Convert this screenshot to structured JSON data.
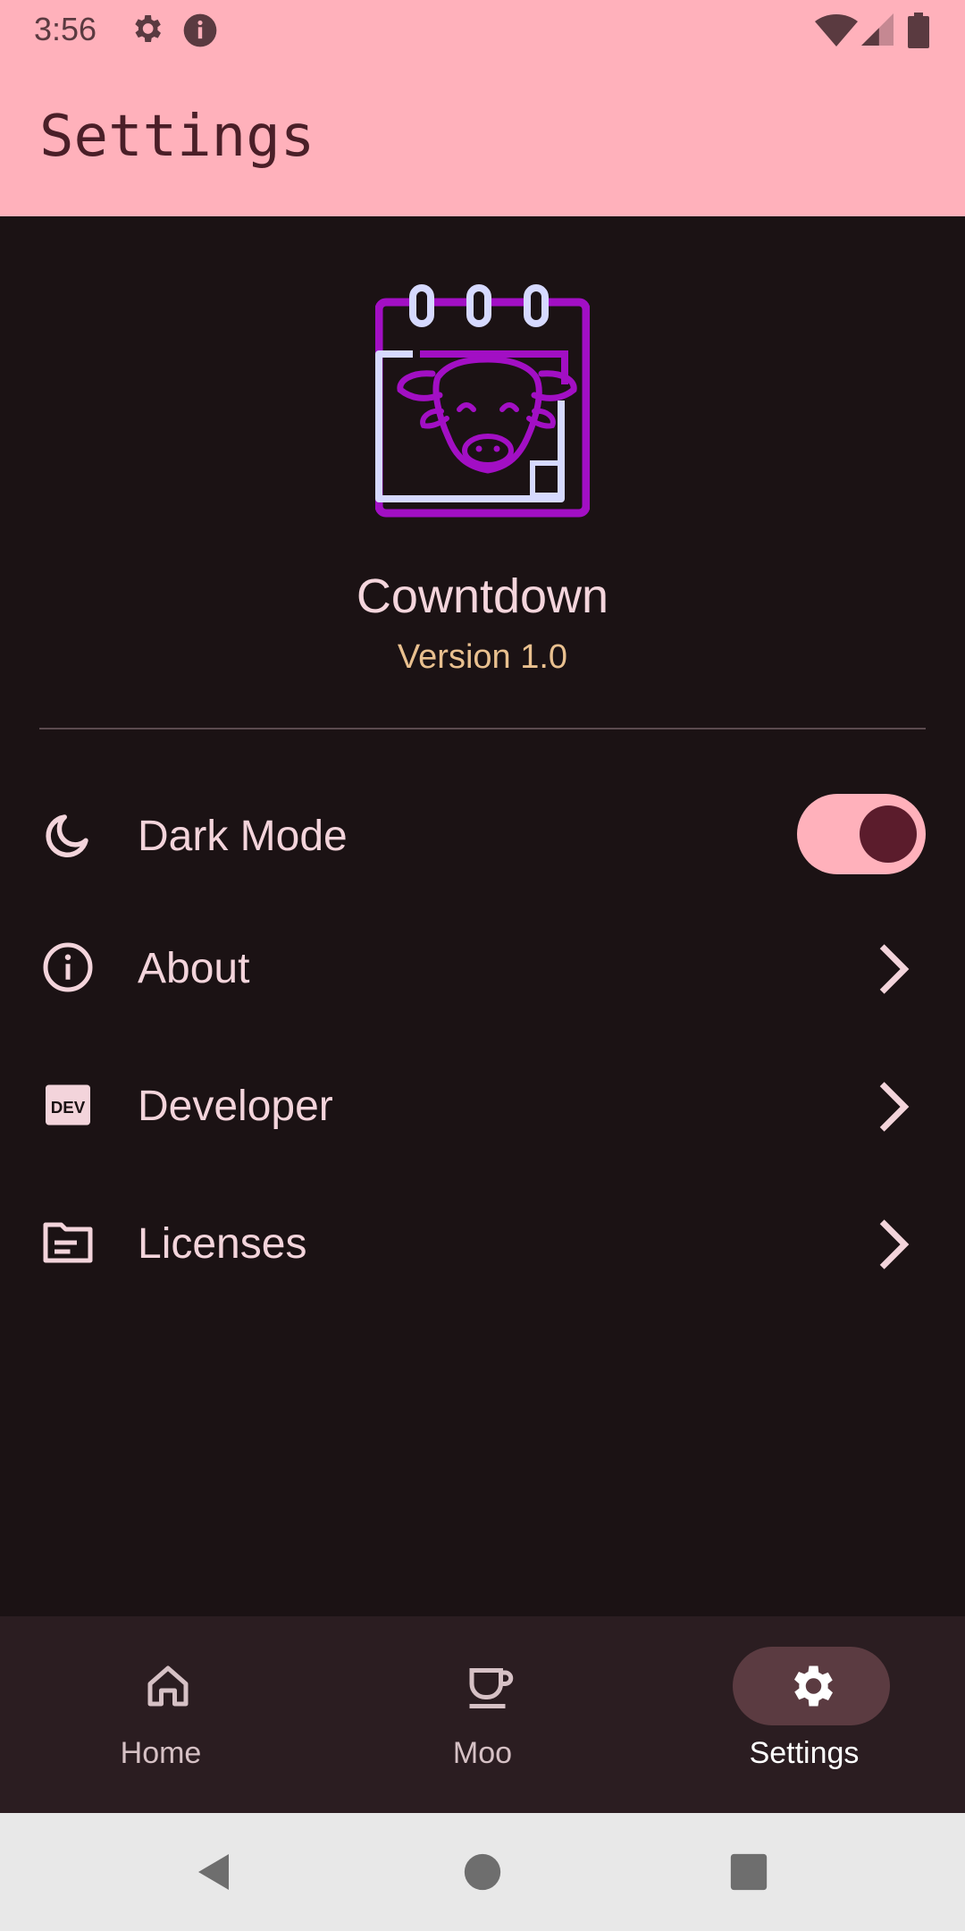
{
  "status_bar": {
    "time": "3:56"
  },
  "app_bar": {
    "title": "Settings"
  },
  "about": {
    "app_name": "Cowntdown",
    "version": "Version 1.0"
  },
  "settings": [
    {
      "label": "Dark Mode",
      "icon": "moon-icon",
      "control": "toggle",
      "toggle_on": true
    },
    {
      "label": "About",
      "icon": "info-icon",
      "control": "chevron"
    },
    {
      "label": "Developer",
      "icon": "dev-icon",
      "control": "chevron"
    },
    {
      "label": "Licenses",
      "icon": "document-icon",
      "control": "chevron"
    }
  ],
  "bottom_nav": {
    "items": [
      {
        "label": "Home",
        "icon": "home-icon"
      },
      {
        "label": "Moo",
        "icon": "cup-icon"
      },
      {
        "label": "Settings",
        "icon": "gear-icon",
        "active": true
      }
    ]
  },
  "colors": {
    "app_bar": "#ffb1bb",
    "background": "#1b1214",
    "text": "#f3d4db",
    "version": "#e9c08f",
    "logo_purple": "#a20fc4",
    "logo_lavender": "#d6d9ff"
  }
}
